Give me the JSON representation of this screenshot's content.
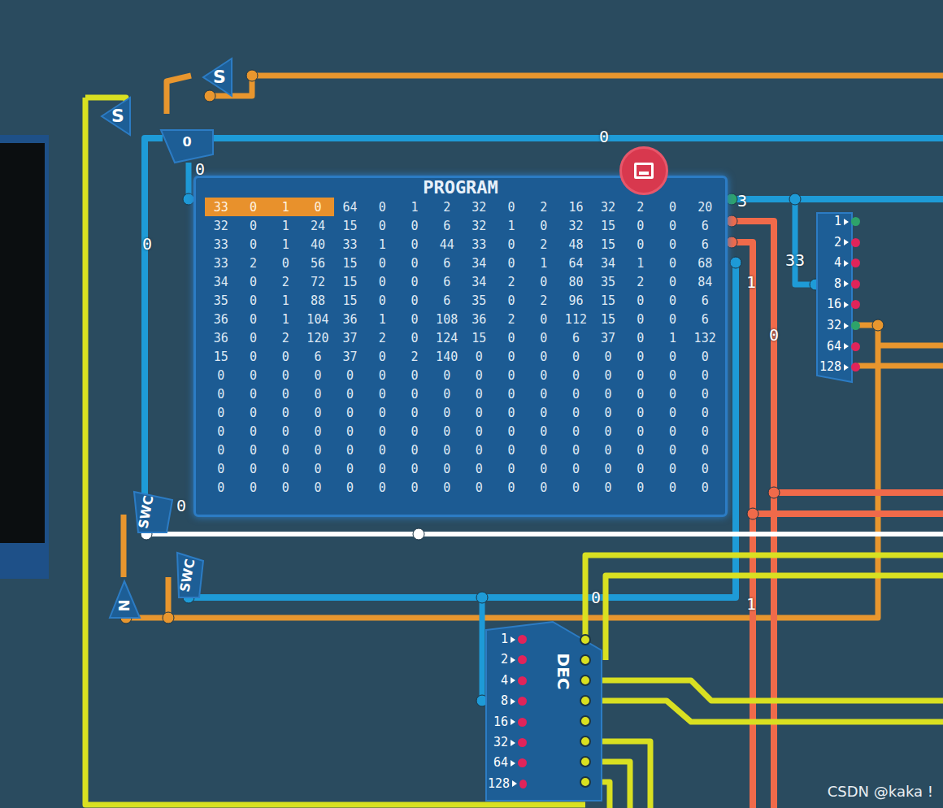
{
  "components": [
    {
      "label": "S"
    },
    {
      "label": "S"
    },
    {
      "label": "0"
    },
    {
      "label": "SWC"
    },
    {
      "label": "SWC"
    },
    {
      "label": "N"
    }
  ],
  "wire_labels": [
    {
      "text": "0"
    },
    {
      "text": "0"
    },
    {
      "text": "0"
    },
    {
      "text": "3"
    },
    {
      "text": "33"
    },
    {
      "text": "1"
    },
    {
      "text": "0"
    },
    {
      "text": "0"
    },
    {
      "text": "0"
    },
    {
      "text": "1"
    }
  ],
  "program": {
    "title": "PROGRAM",
    "rows": [
      {
        "cells": [
          "33",
          "0",
          "1",
          "0",
          "64",
          "0",
          "1",
          "2",
          "32",
          "0",
          "2",
          "16",
          "32",
          "2",
          "0",
          "20"
        ],
        "selected": [
          true,
          true,
          true,
          true,
          false,
          false,
          false,
          false,
          false,
          false,
          false,
          false,
          false,
          false,
          false,
          false
        ]
      },
      {
        "cells": [
          "32",
          "0",
          "1",
          "24",
          "15",
          "0",
          "0",
          "6",
          "32",
          "1",
          "0",
          "32",
          "15",
          "0",
          "0",
          "6"
        ],
        "selected": [
          false,
          false,
          false,
          false,
          false,
          false,
          false,
          false,
          false,
          false,
          false,
          false,
          false,
          false,
          false,
          false
        ]
      },
      {
        "cells": [
          "33",
          "0",
          "1",
          "40",
          "33",
          "1",
          "0",
          "44",
          "33",
          "0",
          "2",
          "48",
          "15",
          "0",
          "0",
          "6"
        ],
        "selected": [
          false,
          false,
          false,
          false,
          false,
          false,
          false,
          false,
          false,
          false,
          false,
          false,
          false,
          false,
          false,
          false
        ]
      },
      {
        "cells": [
          "33",
          "2",
          "0",
          "56",
          "15",
          "0",
          "0",
          "6",
          "34",
          "0",
          "1",
          "64",
          "34",
          "1",
          "0",
          "68"
        ],
        "selected": [
          false,
          false,
          false,
          false,
          false,
          false,
          false,
          false,
          false,
          false,
          false,
          false,
          false,
          false,
          false,
          false
        ]
      },
      {
        "cells": [
          "34",
          "0",
          "2",
          "72",
          "15",
          "0",
          "0",
          "6",
          "34",
          "2",
          "0",
          "80",
          "35",
          "2",
          "0",
          "84"
        ],
        "selected": [
          false,
          false,
          false,
          false,
          false,
          false,
          false,
          false,
          false,
          false,
          false,
          false,
          false,
          false,
          false,
          false
        ]
      },
      {
        "cells": [
          "35",
          "0",
          "1",
          "88",
          "15",
          "0",
          "0",
          "6",
          "35",
          "0",
          "2",
          "96",
          "15",
          "0",
          "0",
          "6"
        ],
        "selected": [
          false,
          false,
          false,
          false,
          false,
          false,
          false,
          false,
          false,
          false,
          false,
          false,
          false,
          false,
          false,
          false
        ]
      },
      {
        "cells": [
          "36",
          "0",
          "1",
          "104",
          "36",
          "1",
          "0",
          "108",
          "36",
          "2",
          "0",
          "112",
          "15",
          "0",
          "0",
          "6"
        ],
        "selected": [
          false,
          false,
          false,
          false,
          false,
          false,
          false,
          false,
          false,
          false,
          false,
          false,
          false,
          false,
          false,
          false
        ]
      },
      {
        "cells": [
          "36",
          "0",
          "2",
          "120",
          "37",
          "2",
          "0",
          "124",
          "15",
          "0",
          "0",
          "6",
          "37",
          "0",
          "1",
          "132"
        ],
        "selected": [
          false,
          false,
          false,
          false,
          false,
          false,
          false,
          false,
          false,
          false,
          false,
          false,
          false,
          false,
          false,
          false
        ]
      },
      {
        "cells": [
          "15",
          "0",
          "0",
          "6",
          "37",
          "0",
          "2",
          "140",
          "0",
          "0",
          "0",
          "0",
          "0",
          "0",
          "0",
          "0"
        ],
        "selected": [
          false,
          false,
          false,
          false,
          false,
          false,
          false,
          false,
          false,
          false,
          false,
          false,
          false,
          false,
          false,
          false
        ]
      },
      {
        "cells": [
          "0",
          "0",
          "0",
          "0",
          "0",
          "0",
          "0",
          "0",
          "0",
          "0",
          "0",
          "0",
          "0",
          "0",
          "0",
          "0"
        ],
        "selected": [
          false,
          false,
          false,
          false,
          false,
          false,
          false,
          false,
          false,
          false,
          false,
          false,
          false,
          false,
          false,
          false
        ]
      },
      {
        "cells": [
          "0",
          "0",
          "0",
          "0",
          "0",
          "0",
          "0",
          "0",
          "0",
          "0",
          "0",
          "0",
          "0",
          "0",
          "0",
          "0"
        ],
        "selected": [
          false,
          false,
          false,
          false,
          false,
          false,
          false,
          false,
          false,
          false,
          false,
          false,
          false,
          false,
          false,
          false
        ]
      },
      {
        "cells": [
          "0",
          "0",
          "0",
          "0",
          "0",
          "0",
          "0",
          "0",
          "0",
          "0",
          "0",
          "0",
          "0",
          "0",
          "0",
          "0"
        ],
        "selected": [
          false,
          false,
          false,
          false,
          false,
          false,
          false,
          false,
          false,
          false,
          false,
          false,
          false,
          false,
          false,
          false
        ]
      },
      {
        "cells": [
          "0",
          "0",
          "0",
          "0",
          "0",
          "0",
          "0",
          "0",
          "0",
          "0",
          "0",
          "0",
          "0",
          "0",
          "0",
          "0"
        ],
        "selected": [
          false,
          false,
          false,
          false,
          false,
          false,
          false,
          false,
          false,
          false,
          false,
          false,
          false,
          false,
          false,
          false
        ]
      },
      {
        "cells": [
          "0",
          "0",
          "0",
          "0",
          "0",
          "0",
          "0",
          "0",
          "0",
          "0",
          "0",
          "0",
          "0",
          "0",
          "0",
          "0"
        ],
        "selected": [
          false,
          false,
          false,
          false,
          false,
          false,
          false,
          false,
          false,
          false,
          false,
          false,
          false,
          false,
          false,
          false
        ]
      },
      {
        "cells": [
          "0",
          "0",
          "0",
          "0",
          "0",
          "0",
          "0",
          "0",
          "0",
          "0",
          "0",
          "0",
          "0",
          "0",
          "0",
          "0"
        ],
        "selected": [
          false,
          false,
          false,
          false,
          false,
          false,
          false,
          false,
          false,
          false,
          false,
          false,
          false,
          false,
          false,
          false
        ]
      },
      {
        "cells": [
          "0",
          "0",
          "0",
          "0",
          "0",
          "0",
          "0",
          "0",
          "0",
          "0",
          "0",
          "0",
          "0",
          "0",
          "0",
          "0"
        ],
        "selected": [
          false,
          false,
          false,
          false,
          false,
          false,
          false,
          false,
          false,
          false,
          false,
          false,
          false,
          false,
          false,
          false
        ]
      }
    ]
  },
  "splitter": {
    "pins": [
      {
        "label": "1",
        "on": true
      },
      {
        "label": "2",
        "on": false
      },
      {
        "label": "4",
        "on": false
      },
      {
        "label": "8",
        "on": false
      },
      {
        "label": "16",
        "on": false
      },
      {
        "label": "32",
        "on": true
      },
      {
        "label": "64",
        "on": false
      },
      {
        "label": "128",
        "on": false
      }
    ]
  },
  "decoder": {
    "label": "DEC",
    "pins": [
      {
        "label": "1",
        "on": false
      },
      {
        "label": "2",
        "on": false
      },
      {
        "label": "4",
        "on": false
      },
      {
        "label": "8",
        "on": false
      },
      {
        "label": "16",
        "on": false
      },
      {
        "label": "32",
        "on": false
      },
      {
        "label": "64",
        "on": false
      },
      {
        "label": "128",
        "on": false
      }
    ]
  },
  "watermark": "CSDN @kaka !"
}
